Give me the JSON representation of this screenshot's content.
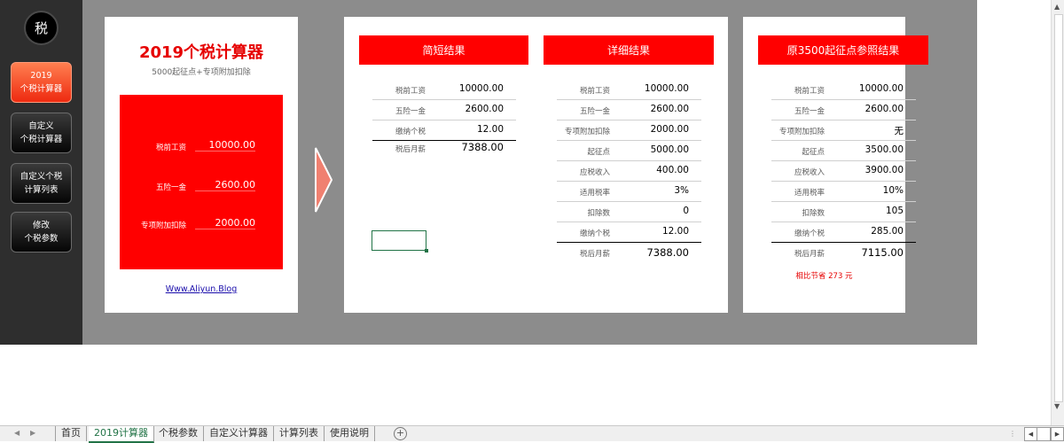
{
  "sidebar": {
    "logo": "税",
    "buttons": [
      {
        "line1": "2019",
        "line2": "个税计算器"
      },
      {
        "line1": "自定义",
        "line2": "个税计算器"
      },
      {
        "line1": "自定义个税",
        "line2": "计算列表"
      },
      {
        "line1": "修改",
        "line2": "个税参数"
      }
    ]
  },
  "calculator": {
    "title": "2019个税计算器",
    "subtitle": "5000起征点+专项附加扣除",
    "inputs": [
      {
        "label": "税前工资",
        "value": "10000.00"
      },
      {
        "label": "五险一金",
        "value": "2600.00"
      },
      {
        "label": "专项附加扣除",
        "value": "2000.00"
      }
    ],
    "link": "Www.Aliyun.Blog"
  },
  "brief": {
    "header": "简短结果",
    "rows": [
      {
        "label": "税前工资",
        "value": "10000.00"
      },
      {
        "label": "五险一金",
        "value": "2600.00"
      },
      {
        "label": "缴纳个税",
        "value": "12.00"
      },
      {
        "label": "税后月薪",
        "value": "7388.00"
      }
    ]
  },
  "detail": {
    "header": "详细结果",
    "rows": [
      {
        "label": "税前工资",
        "value": "10000.00"
      },
      {
        "label": "五险一金",
        "value": "2600.00"
      },
      {
        "label": "专项附加扣除",
        "value": "2000.00"
      },
      {
        "label": "起征点",
        "value": "5000.00"
      },
      {
        "label": "应税收入",
        "value": "400.00"
      },
      {
        "label": "适用税率",
        "value": "3%"
      },
      {
        "label": "扣除数",
        "value": "0"
      },
      {
        "label": "缴纳个税",
        "value": "12.00"
      },
      {
        "label": "税后月薪",
        "value": "7388.00"
      }
    ]
  },
  "original": {
    "header": "原3500起征点参照结果",
    "rows": [
      {
        "label": "税前工资",
        "value": "10000.00"
      },
      {
        "label": "五险一金",
        "value": "2600.00"
      },
      {
        "label": "专项附加扣除",
        "value": "无"
      },
      {
        "label": "起征点",
        "value": "3500.00"
      },
      {
        "label": "应税收入",
        "value": "3900.00"
      },
      {
        "label": "适用税率",
        "value": "10%"
      },
      {
        "label": "扣除数",
        "value": "105"
      },
      {
        "label": "缴纳个税",
        "value": "285.00"
      },
      {
        "label": "税后月薪",
        "value": "7115.00"
      }
    ],
    "saving": "相比节省 273 元"
  },
  "tabs": {
    "items": [
      "首页",
      "2019计算器",
      "个税参数",
      "自定义计算器",
      "计算列表",
      "使用说明"
    ],
    "active_index": 1,
    "add": "+",
    "dots": "⋮"
  },
  "colors": {
    "accent": "#ff0000",
    "excel_green": "#217346"
  }
}
